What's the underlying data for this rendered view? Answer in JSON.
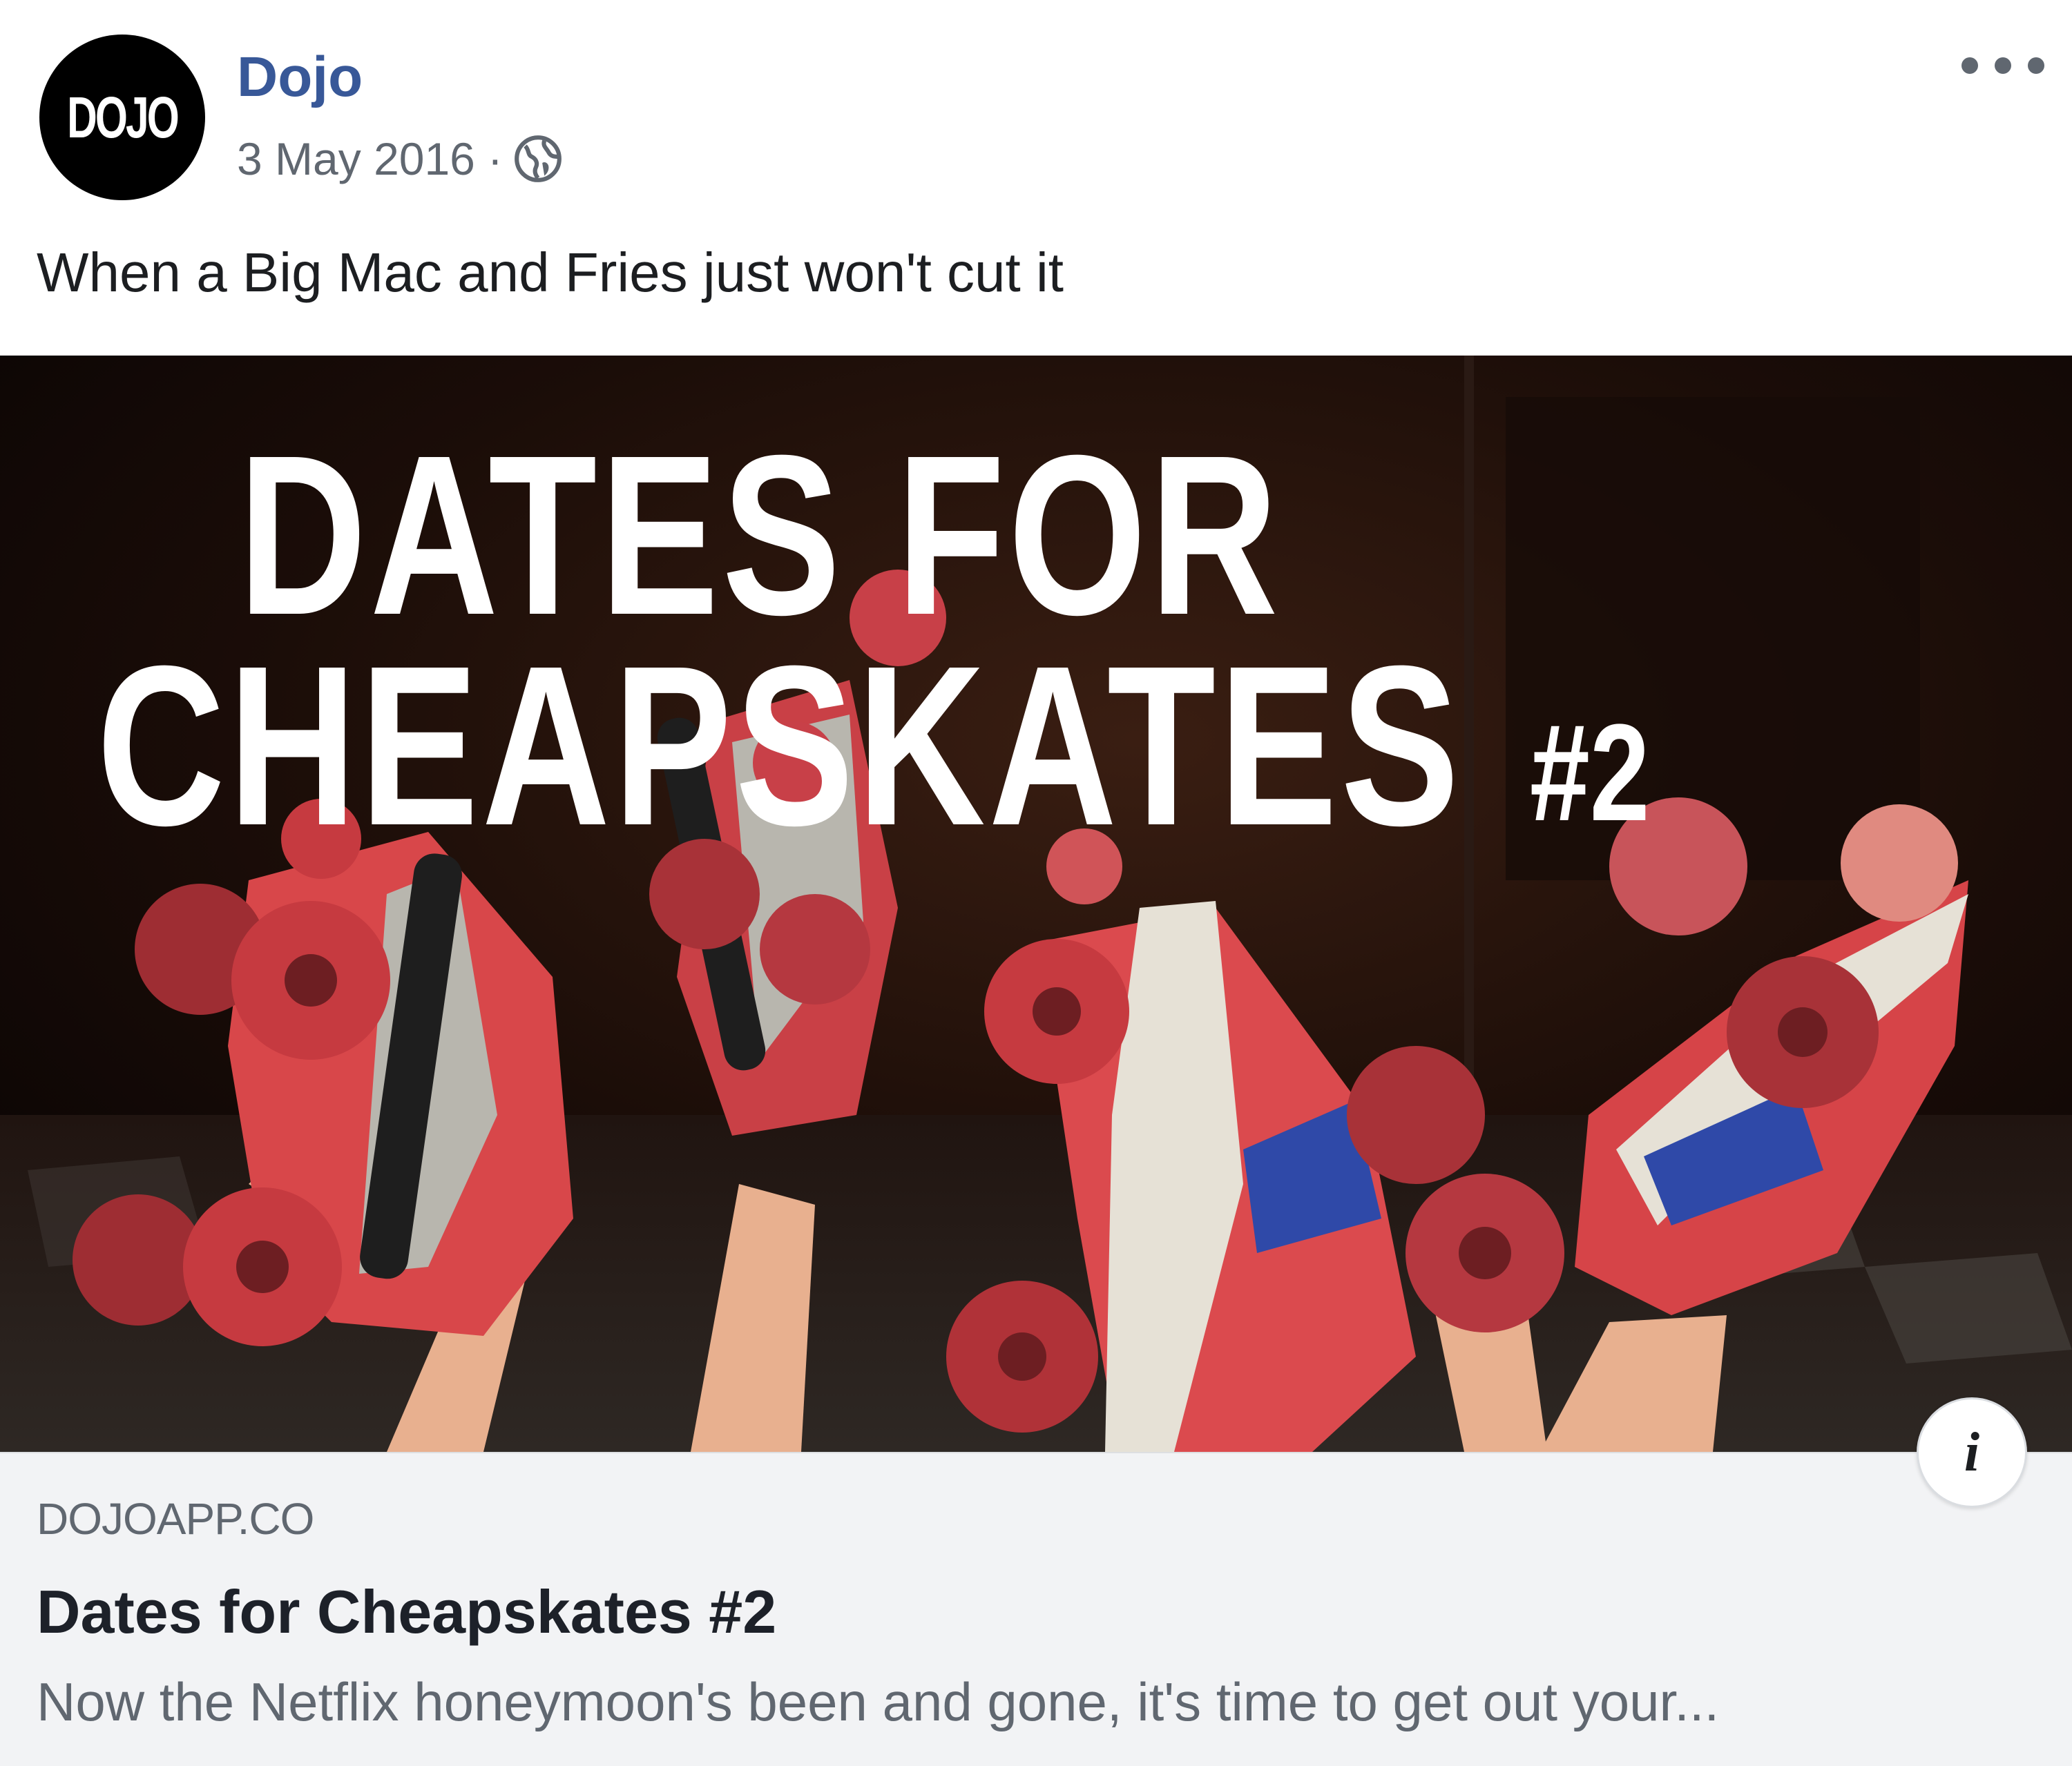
{
  "post": {
    "avatar_text": "DOJO",
    "page_name": "Dojo",
    "date": "3 May 2016",
    "separator": "·",
    "privacy_icon": "globe-icon",
    "more_icon": "more-options-icon",
    "caption": "When a Big Mac and Fries just won't cut it"
  },
  "image": {
    "headline_line1": "DATES FOR",
    "headline_line2": "CHEAPSKATES",
    "headline_number": "#2",
    "info_icon": "i"
  },
  "link": {
    "domain": "DOJOAPP.CO",
    "title": "Dates for Cheapskates #2",
    "description": "Now the Netflix honeymoon's been and gone, it's time to get out your..."
  },
  "colors": {
    "page_name": "#385898",
    "meta_text": "#606770",
    "link_background": "#f2f3f5",
    "skate_red": "#d94a4a"
  }
}
